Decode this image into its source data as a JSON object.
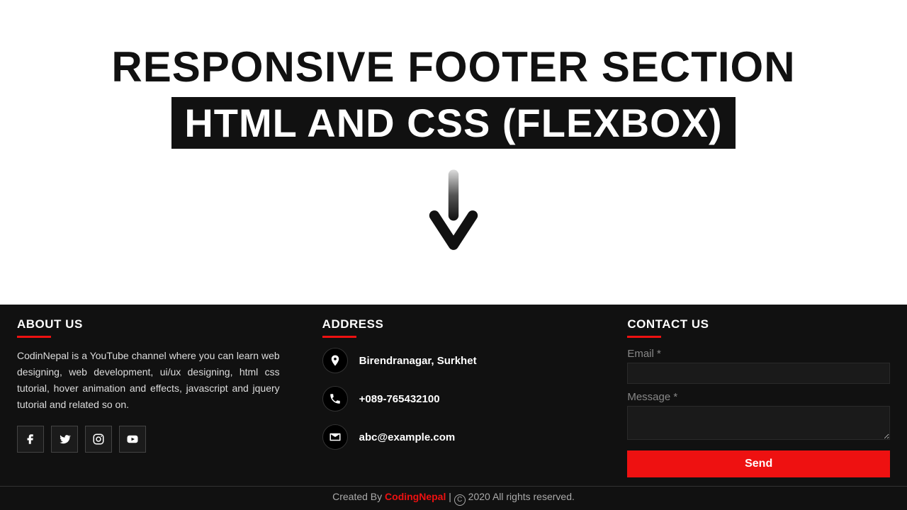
{
  "hero": {
    "title": "RESPONSIVE FOOTER SECTION",
    "subtitle": "HTML AND CSS (FLEXBOX)"
  },
  "about": {
    "heading": "ABOUT US",
    "text": "CodinNepal is a YouTube channel where you can learn web designing, web development, ui/ux designing, html css tutorial, hover animation and effects, javascript and jquery tutorial and related so on."
  },
  "address": {
    "heading": "ADDRESS",
    "location": "Birendranagar, Surkhet",
    "phone": "+089-765432100",
    "email": "abc@example.com"
  },
  "contact": {
    "heading": "CONTACT US",
    "email_label": "Email *",
    "message_label": "Message *",
    "send_label": "Send"
  },
  "credit": {
    "prefix": "Created By ",
    "brand": "CodingNepal",
    "sep": " | ",
    "rights": " 2020 All rights reserved."
  },
  "social_icons": [
    "facebook",
    "twitter",
    "instagram",
    "youtube"
  ]
}
